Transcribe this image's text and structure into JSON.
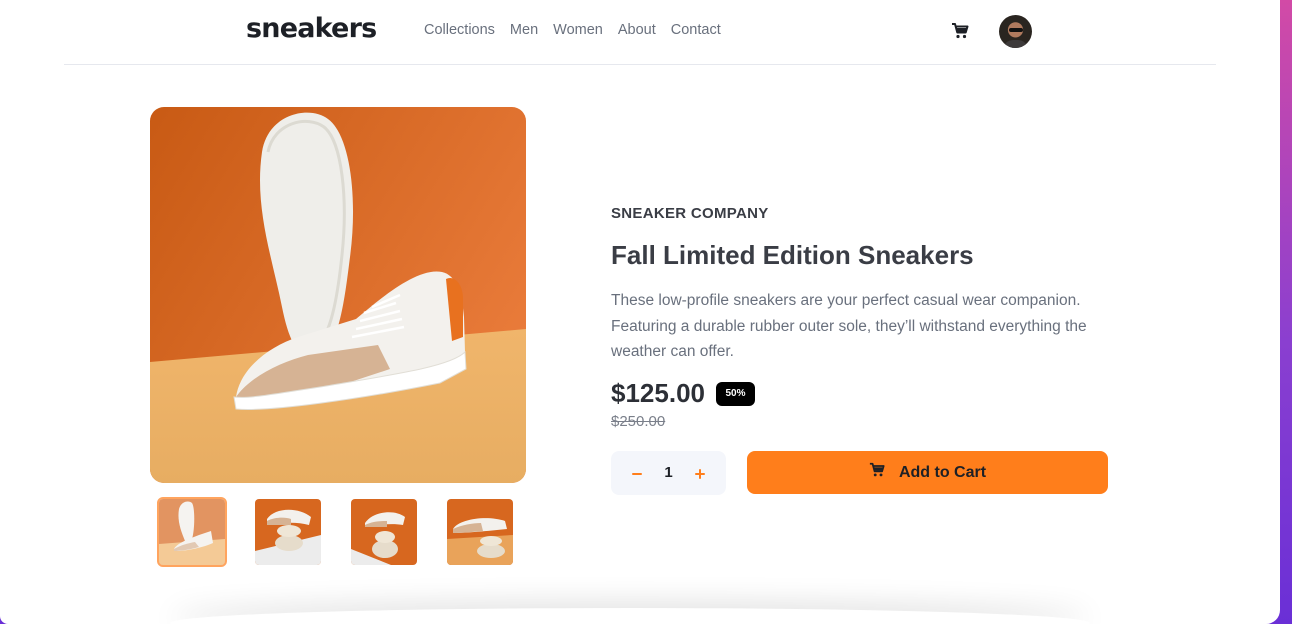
{
  "brand": {
    "logo": "sneakers"
  },
  "nav": {
    "links": [
      "Collections",
      "Men",
      "Women",
      "About",
      "Contact"
    ]
  },
  "header_icons": {
    "cart": "cart-icon",
    "avatar": "user-avatar"
  },
  "product": {
    "company": "SNEAKER COMPANY",
    "title": "Fall Limited Edition Sneakers",
    "description": "These low-profile sneakers are your perfect casual wear companion. Featuring a durable rubber outer sole, they’ll withstand everything the weather can offer.",
    "price": "$125.00",
    "discount": "50%",
    "original_price": "$250.00"
  },
  "quantity": {
    "value": "1"
  },
  "actions": {
    "add_to_cart": "Add to Cart"
  },
  "gallery": {
    "selected_index": 0,
    "thumbnail_count": 4
  },
  "colors": {
    "accent": "#ff7e1b",
    "text_dark": "#1d2026",
    "text_muted": "#69707d"
  }
}
